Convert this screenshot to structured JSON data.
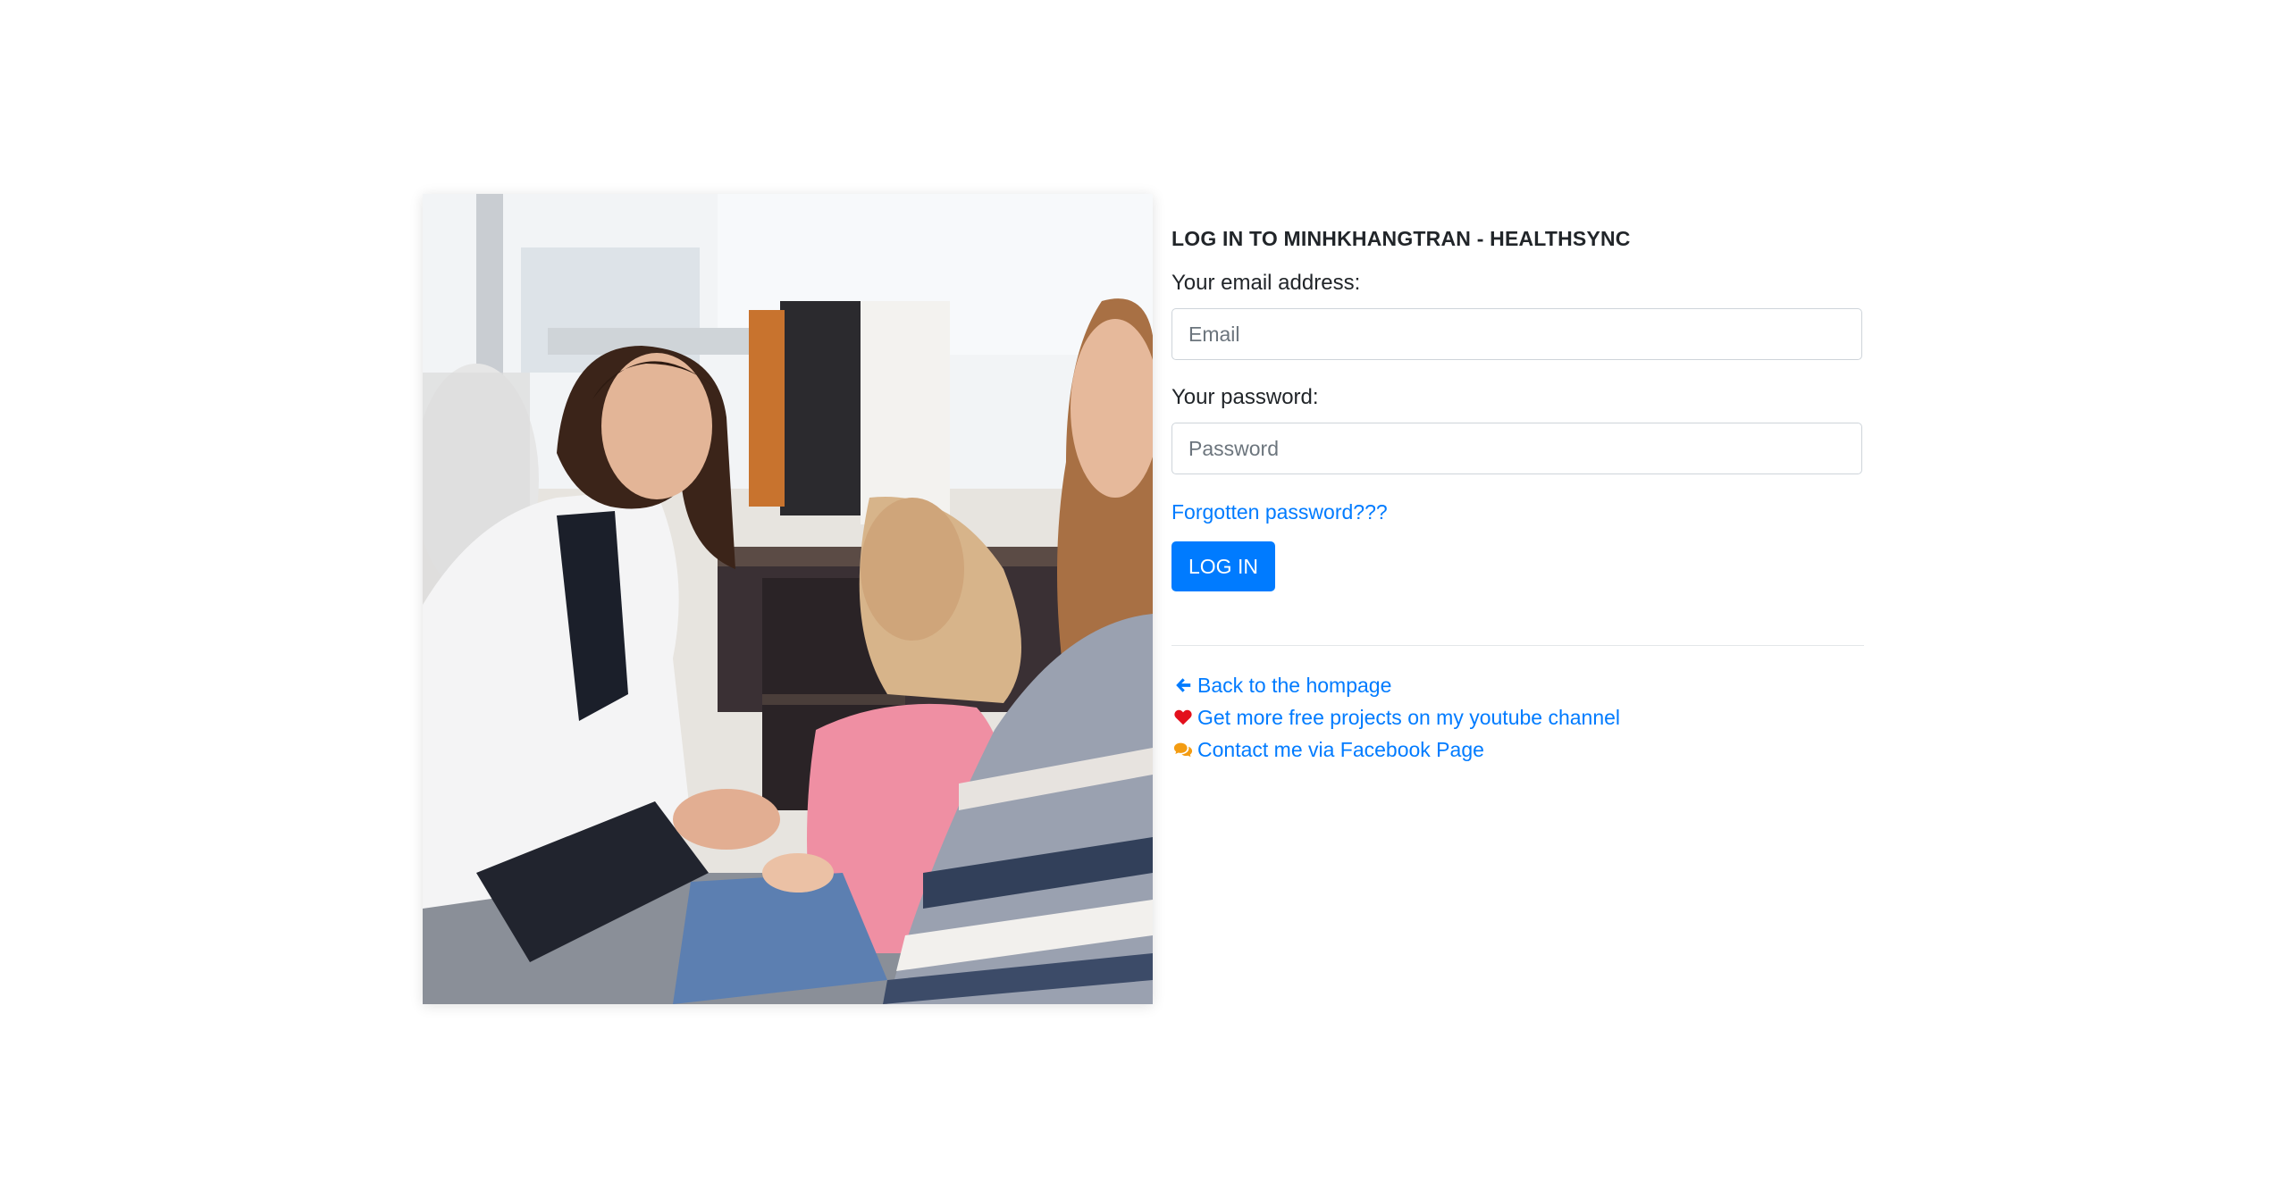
{
  "login": {
    "title": "LOG IN TO MINHKHANGTRAN - HEALTHSYNC",
    "email_label": "Your email address:",
    "email_placeholder": "Email",
    "email_value": "",
    "password_label": "Your password:",
    "password_placeholder": "Password",
    "password_value": "",
    "forgot_label": "Forgotten password???",
    "submit_label": "LOG IN"
  },
  "links": [
    {
      "label": "Back to the hompage",
      "icon": "arrow-left-icon",
      "icon_color": "#007bff"
    },
    {
      "label": "Get more free projects on my youtube channel",
      "icon": "heart-icon",
      "icon_color": "#e3101c"
    },
    {
      "label": "Contact me via Facebook Page",
      "icon": "comments-icon",
      "icon_color": "#f39c12"
    }
  ],
  "colors": {
    "accent": "#007bff",
    "text": "#212529",
    "input_border": "#ced4da"
  }
}
